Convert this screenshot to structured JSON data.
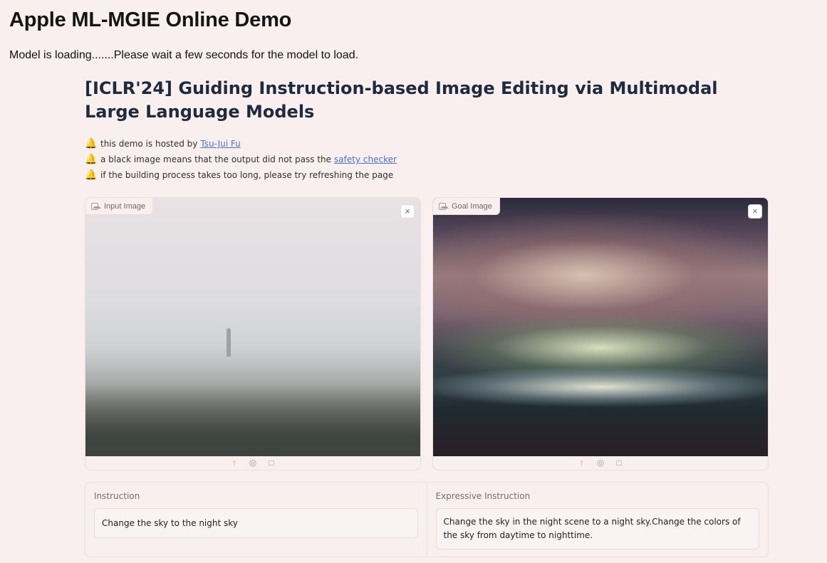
{
  "header": {
    "title": "Apple ML-MGIE Online Demo",
    "status": "Model is loading.......Please wait a few seconds for the model to load."
  },
  "app": {
    "heading": "[ICLR'24] Guiding Instruction-based Image Editing via Multimodal Large Language Models",
    "notes": [
      {
        "icon": "bell-icon",
        "text": "this demo is hosted by",
        "link": "Tsu-Jui Fu",
        "after": ""
      },
      {
        "icon": "bell-icon",
        "text": "a black image means that the output did not pass the",
        "link": "safety checker",
        "after": ""
      },
      {
        "icon": "bell-icon",
        "text": "if the building process takes too long, please try refreshing the page",
        "link": "",
        "after": ""
      }
    ]
  },
  "input_panel": {
    "label": "Input Image",
    "close": "×",
    "tools": [
      "upload-icon",
      "webcam-icon",
      "clipboard-icon"
    ]
  },
  "goal_panel": {
    "label": "Goal Image",
    "close": "×",
    "tools": [
      "upload-icon",
      "webcam-icon",
      "clipboard-icon"
    ]
  },
  "instruction": {
    "label": "Instruction",
    "value": "Change the sky to the night sky"
  },
  "expressive_instruction": {
    "label": "Expressive Instruction",
    "value": "Change the sky in the night scene to a night sky.Change the colors of the sky from daytime to nighttime."
  },
  "colors": {
    "background": "#f9efef",
    "link": "#4b6fd1",
    "accent": "#f08a4b"
  }
}
